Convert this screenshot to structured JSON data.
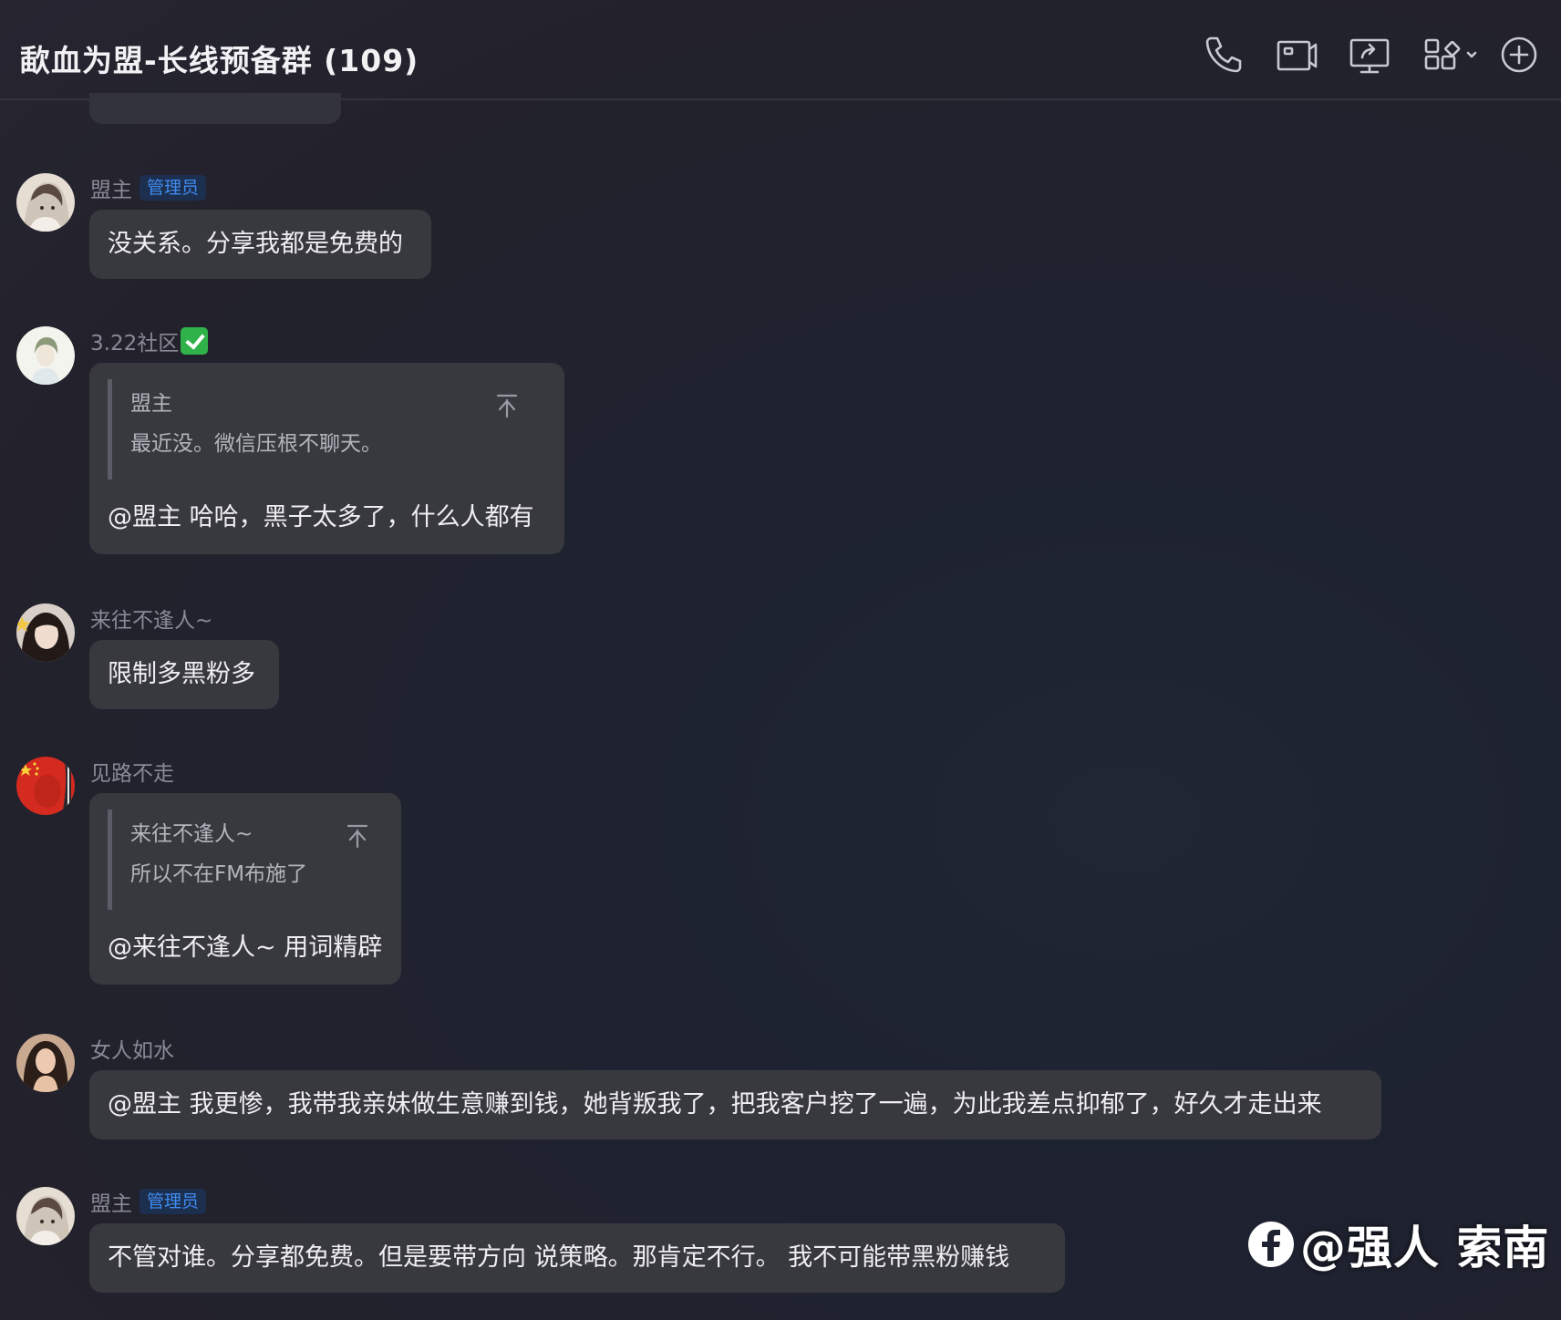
{
  "header": {
    "title": "歃血为盟-长线预备群 (109)",
    "buttons": [
      {
        "name": "voice-call",
        "icon": "phone-icon"
      },
      {
        "name": "video-call",
        "icon": "video-camera-icon"
      },
      {
        "name": "screen-share",
        "icon": "screen-share-icon"
      },
      {
        "name": "apps",
        "icon": "apps-grid-icon"
      },
      {
        "name": "add",
        "icon": "plus-circle-icon"
      }
    ]
  },
  "colors": {
    "background": "#1f2230",
    "bubble": "#38383f",
    "admin_badge_text": "#3f8bf0",
    "admin_badge_bg": "#1d2f4f",
    "verified_green": "#2fb24a"
  },
  "messages": [
    {
      "sender": "盟主",
      "badge": "管理员",
      "text": "没关系。分享我都是免费的"
    },
    {
      "sender": "3.22社区",
      "verified": true,
      "quote": {
        "name": "盟主",
        "text": "最近没。微信压根不聊天。"
      },
      "text": "@盟主 哈哈，黑子太多了，什么人都有"
    },
    {
      "sender": "来往不逢人~",
      "text": "限制多黑粉多"
    },
    {
      "sender": "见路不走",
      "quote": {
        "name": "来往不逢人~",
        "text": "所以不在FM布施了"
      },
      "text": "@来往不逢人~ 用词精辟"
    },
    {
      "sender": "女人如水",
      "text": "@盟主 我更惨，我带我亲妹做生意赚到钱，她背叛我了，把我客户挖了一遍，为此我差点抑郁了，好久才走出来"
    },
    {
      "sender": "盟主",
      "badge": "管理员",
      "text": "不管对谁。分享都免费。但是要带方向 说策略。那肯定不行。 我不可能带黑粉赚钱"
    }
  ],
  "watermark": {
    "text": "@强人 索南"
  }
}
